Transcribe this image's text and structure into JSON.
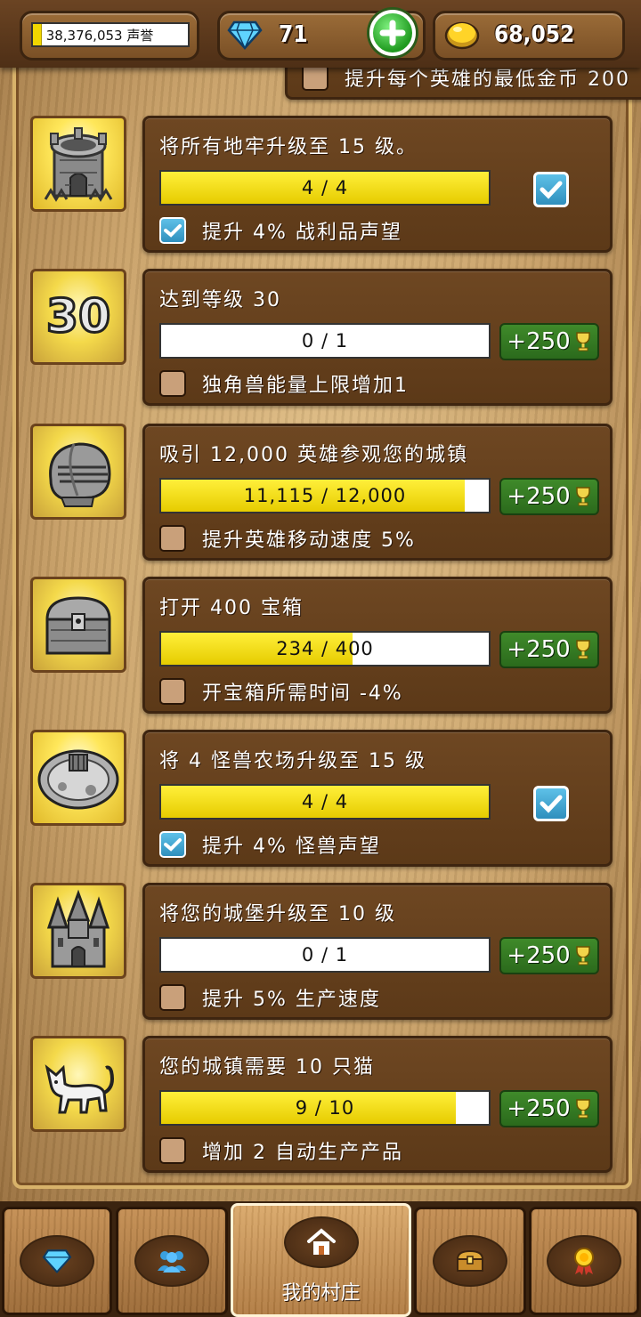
{
  "header": {
    "fame_text": "38,376,053 声誉",
    "gems": "71",
    "gold": "68,052",
    "fame_progress": 0.05
  },
  "partial_row": {
    "perk": "提升每个英雄的最低金币 200"
  },
  "achievements": [
    {
      "icon": "dungeon-tower-icon",
      "title": "将所有地牢升级至 15 级。",
      "progress_text": "4 / 4",
      "progress": 1.0,
      "completed": true,
      "reward": "",
      "perk": "提升 4% 战利品声望",
      "perk_checked": true
    },
    {
      "icon": "level-30-icon",
      "icon_text": "30",
      "title": "达到等级 30",
      "progress_text": "0 / 1",
      "progress": 0.0,
      "completed": false,
      "reward": "+250",
      "perk": "独角兽能量上限增加1",
      "perk_checked": false
    },
    {
      "icon": "knight-helmet-icon",
      "title": "吸引 12,000 英雄参观您的城镇",
      "progress_text": "11,115 / 12,000",
      "progress": 0.926,
      "completed": false,
      "reward": "+250",
      "perk": "提升英雄移动速度 5%",
      "perk_checked": false
    },
    {
      "icon": "treasure-chest-icon",
      "title": "打开 400 宝箱",
      "progress_text": "234 / 400",
      "progress": 0.585,
      "completed": false,
      "reward": "+250",
      "perk": "开宝箱所需时间 -4%",
      "perk_checked": false
    },
    {
      "icon": "monster-farm-icon",
      "title": "将 4 怪兽农场升级至 15 级",
      "progress_text": "4 / 4",
      "progress": 1.0,
      "completed": true,
      "reward": "",
      "perk": "提升 4% 怪兽声望",
      "perk_checked": true
    },
    {
      "icon": "castle-icon",
      "title": "将您的城堡升级至 10 级",
      "progress_text": "0 / 1",
      "progress": 0.0,
      "completed": false,
      "reward": "+250",
      "perk": "提升 5% 生产速度",
      "perk_checked": false
    },
    {
      "icon": "cat-icon",
      "title": "您的城镇需要 10 只猫",
      "progress_text": "9 / 10",
      "progress": 0.9,
      "completed": false,
      "reward": "+250",
      "perk": "增加 2 自动生产产品",
      "perk_checked": false
    }
  ],
  "nav": {
    "items": [
      {
        "icon": "gem-icon"
      },
      {
        "icon": "heroes-icon"
      },
      {
        "icon": "home-icon",
        "label": "我的村庄",
        "active": true
      },
      {
        "icon": "chest-icon"
      },
      {
        "icon": "medal-icon"
      }
    ]
  },
  "colors": {
    "progress_fill": "#f1d700",
    "reward_green": "#2f7a22",
    "card_brown": "#5c3918",
    "check_blue": "#3aa0cf"
  }
}
